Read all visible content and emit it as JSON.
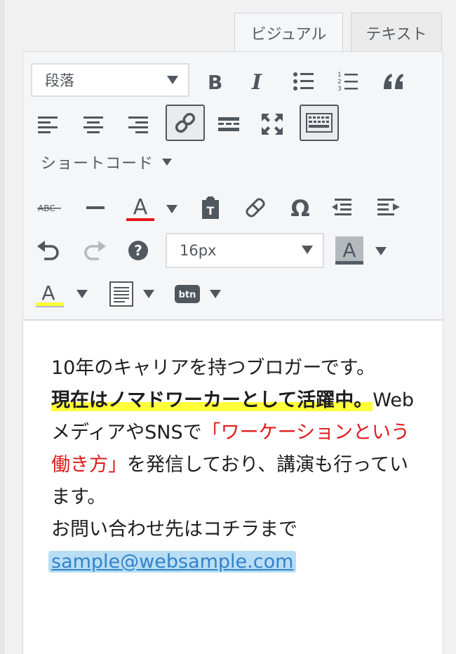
{
  "tabs": {
    "visual": "ビジュアル",
    "text": "テキスト"
  },
  "toolbar": {
    "format_select": "段落",
    "shortcode_label": "ショートコード",
    "font_size_select": "16px",
    "btn_label": "btn",
    "strikethrough_label": "ABC",
    "text_color_letter": "A",
    "bg_color_letter": "A",
    "marker_letter": "A",
    "colors": {
      "text_color_bar": "#e8141b",
      "bg_color_bar": "#555d66",
      "marker_bar": "#ffff3a"
    }
  },
  "content": {
    "line1": "10年のキャリアを持つブロガーです。",
    "bold_highlight": "現在はノマドワーカーとして活躍中。",
    "normal1": "WebメディアやSNSで",
    "red_text": "「ワーケーションという働き方」",
    "normal2": "を発信しており、講演も行っています。",
    "line_contact": "お問い合わせ先はコチラまで",
    "email": "sample@websample.com"
  }
}
